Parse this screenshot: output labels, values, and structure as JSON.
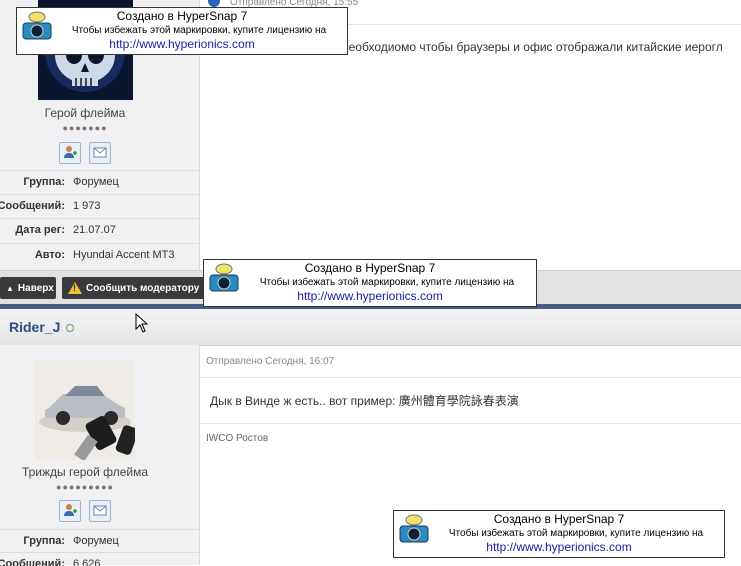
{
  "post1": {
    "header_partial": "Отправлено Сегодня, 15:55",
    "text_partial": "необходиомо чтобы браузеры и офис отображали китайские иерогл",
    "rank": "Герой флейма",
    "pips": "●●●●●●●",
    "info": [
      {
        "label": "Группа:",
        "value": "Форумец"
      },
      {
        "label": "Сообщений:",
        "value": "1 973"
      },
      {
        "label": "Дата рег:",
        "value": "21.07.07"
      },
      {
        "label": "Авто:",
        "value": "Hyundai Accent MT3"
      }
    ]
  },
  "actions": {
    "top_label": "Наверх",
    "report_label": "Сообщить модератору"
  },
  "post2": {
    "username": "Rider_J",
    "header": "Отправлено Сегодня, 16:07",
    "text": "Дык в Винде ж есть.. вот пример: 廣州體育學院詠春表演",
    "signature": "IWCO Ростов",
    "rank": "Трижды герой флейма",
    "pips": "●●●●●●●●●",
    "info": [
      {
        "label": "Группа:",
        "value": "Форумец"
      },
      {
        "label": "Сообщений:",
        "value": "6 626"
      }
    ]
  },
  "watermark": {
    "title": "Создано в HyperSnap 7",
    "subtitle": "Чтобы избежать этой маркировки, купите лицензию на",
    "url": "http://www.hyperionics.com"
  },
  "colors": {
    "accent_blue": "#475f86",
    "username": "#2d4d83",
    "action_button": "#3a3a3c"
  }
}
